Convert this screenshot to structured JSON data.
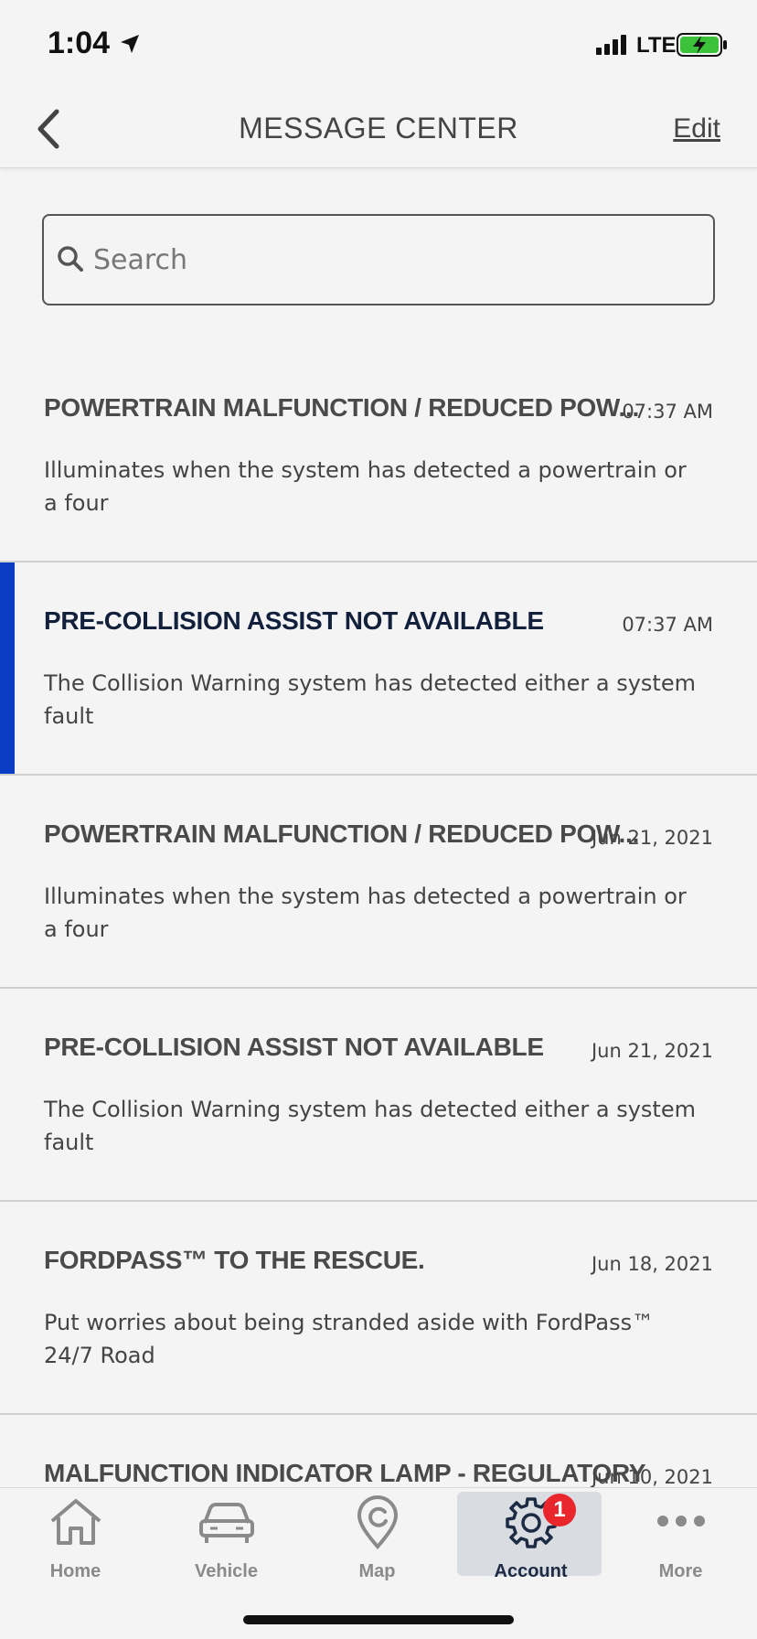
{
  "status_bar": {
    "time": "1:04",
    "network": "LTE"
  },
  "nav": {
    "title": "MESSAGE CENTER",
    "edit_label": "Edit"
  },
  "search": {
    "placeholder": "Search"
  },
  "messages": [
    {
      "title": "POWERTRAIN MALFUNCTION / REDUCED POW...",
      "time": "07:37 AM",
      "body": "Illuminates when the system has detected a powertrain or a four",
      "selected": false
    },
    {
      "title": "PRE-COLLISION ASSIST NOT AVAILABLE",
      "time": "07:37 AM",
      "body": "The Collision Warning system has detected either a system fault",
      "selected": true
    },
    {
      "title": "POWERTRAIN MALFUNCTION / REDUCED POW...",
      "time": "Jun 21, 2021",
      "body": "Illuminates when the system has detected a powertrain or a four",
      "selected": false
    },
    {
      "title": "PRE-COLLISION ASSIST NOT AVAILABLE",
      "time": "Jun 21, 2021",
      "body": "The Collision Warning system has detected either a system fault",
      "selected": false
    },
    {
      "title": "FORDPASS™ TO THE RESCUE.",
      "time": "Jun 18, 2021",
      "body": "Put worries about being stranded aside with FordPass™ 24/7 Road",
      "selected": false
    },
    {
      "title": "MALFUNCTION INDICATOR LAMP - REGULATORY",
      "time": "Jun 10, 2021",
      "body": "",
      "selected": false
    }
  ],
  "tabs": [
    {
      "label": "Home",
      "icon": "home-icon"
    },
    {
      "label": "Vehicle",
      "icon": "vehicle-icon"
    },
    {
      "label": "Map",
      "icon": "map-pin-icon"
    },
    {
      "label": "Account",
      "icon": "gear-icon",
      "badge": "1",
      "active": true
    },
    {
      "label": "More",
      "icon": "more-icon"
    }
  ],
  "colors": {
    "accent": "#0a3dc4",
    "badge": "#e8262c",
    "battery": "#3cc13b"
  }
}
